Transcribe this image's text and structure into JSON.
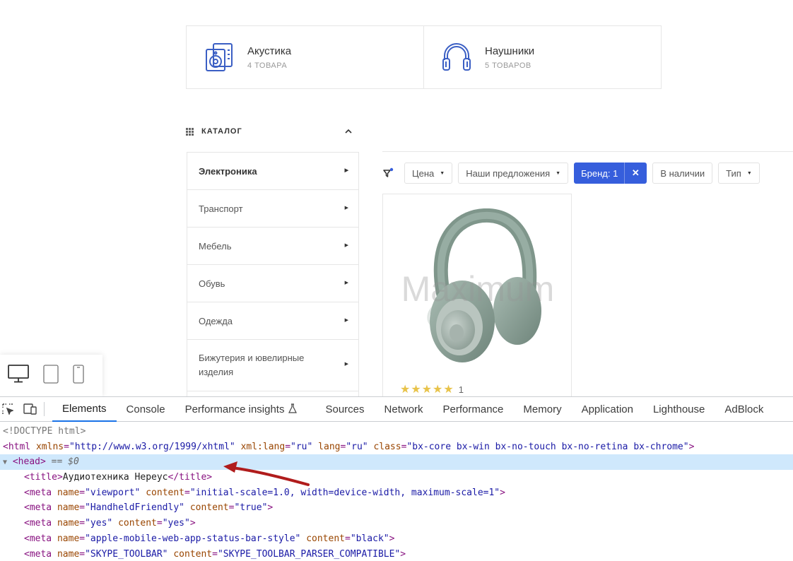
{
  "categories": [
    {
      "name": "Акустика",
      "count": "4 ТОВАРА",
      "icon": "speaker-icon"
    },
    {
      "name": "Наушники",
      "count": "5 ТОВАРОВ",
      "icon": "headphones-icon"
    }
  ],
  "catalog": {
    "title": "КАТАЛОГ",
    "chevron": "˄",
    "items": [
      {
        "label": "Электроника",
        "active": true
      },
      {
        "label": "Транспорт"
      },
      {
        "label": "Мебель"
      },
      {
        "label": "Обувь"
      },
      {
        "label": "Одежда"
      },
      {
        "label": "Бижутерия и ювелирные изделия"
      }
    ]
  },
  "filters": {
    "price": "Цена",
    "offers": "Наши предложения",
    "brand": "Бренд: 1",
    "brand_clear": "✕",
    "in_stock": "В наличии",
    "type": "Тип"
  },
  "product": {
    "watermark": "Maximum",
    "stars": "★★★★★",
    "rating_count": "1"
  },
  "devtools": {
    "tabs": [
      "Elements",
      "Console",
      "Performance insights",
      "Sources",
      "Network",
      "Performance",
      "Memory",
      "Application",
      "Lighthouse",
      "AdBlock"
    ],
    "active_tab": "Elements",
    "code": {
      "doctype": "<!DOCTYPE html>",
      "html_open": "<html",
      "html_attr1": "xmlns",
      "html_val1": "\"http://www.w3.org/1999/xhtml\"",
      "html_attr2": "xml:lang",
      "html_val2": "\"ru\"",
      "html_attr3": "lang",
      "html_val3": "\"ru\"",
      "html_attr4": "class",
      "html_val4": "\"bx-core bx-win bx-no-touch bx-no-retina bx-chrome\"",
      "head_tag": "<head>",
      "head_eq": "== $0",
      "title_open": "<title>",
      "title_text": "Аудиотехника Нереус",
      "title_close": "</title>",
      "metas": [
        {
          "n": "\"viewport\"",
          "c": "\"initial-scale=1.0, width=device-width, maximum-scale=1\""
        },
        {
          "n": "\"HandheldFriendly\"",
          "c": "\"true\""
        },
        {
          "n": "\"yes\"",
          "c": "\"yes\""
        },
        {
          "n": "\"apple-mobile-web-app-status-bar-style\"",
          "c": "\"black\""
        },
        {
          "n": "\"SKYPE_TOOLBAR\"",
          "c": "\"SKYPE_TOOLBAR_PARSER_COMPATIBLE\""
        }
      ]
    }
  },
  "colors": {
    "accent": "#365edc",
    "star": "#e8c34a",
    "annotation_arrow": "#b01c1c"
  }
}
